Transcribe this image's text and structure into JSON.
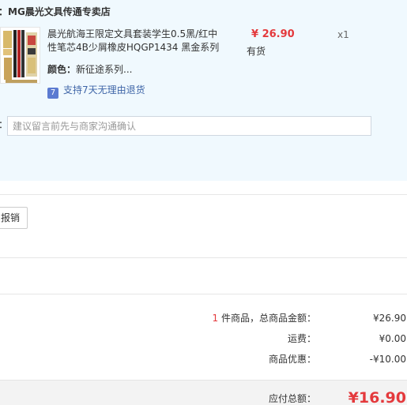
{
  "order": {
    "shop_prefix": "：",
    "shop_name": "MG晨光文具传通专卖店",
    "product": {
      "title": "晨光航海王限定文具套装学生0.5黑/红中性笔芯4B少屑橡皮HQGP1434 黑金系列",
      "price": "¥ 26.90",
      "stock": "有货",
      "quantity": "x1",
      "color_label": "颜色：",
      "color_value": "新征途系列...",
      "return_badge": "7",
      "return_policy": "支持7天无理由退货"
    },
    "memo": {
      "prefix": "：",
      "placeholder": "建议留言前先与商家沟通确认",
      "value": ""
    }
  },
  "invoice": {
    "button_label": "报销"
  },
  "summary": {
    "count": "1",
    "goods_label": " 件商品，总商品金额：",
    "goods_total": "¥26.90",
    "shipping_label": "运费：",
    "shipping_value": "¥0.00",
    "discount_label": "商品优惠：",
    "discount_value": "-¥10.00",
    "payable_label": "应付总额：",
    "payable_value": "¥16.90"
  },
  "colors": {
    "accent_red": "#e4393c",
    "order_background": "#f0f9fe",
    "link_blue": "#3f66a8"
  }
}
